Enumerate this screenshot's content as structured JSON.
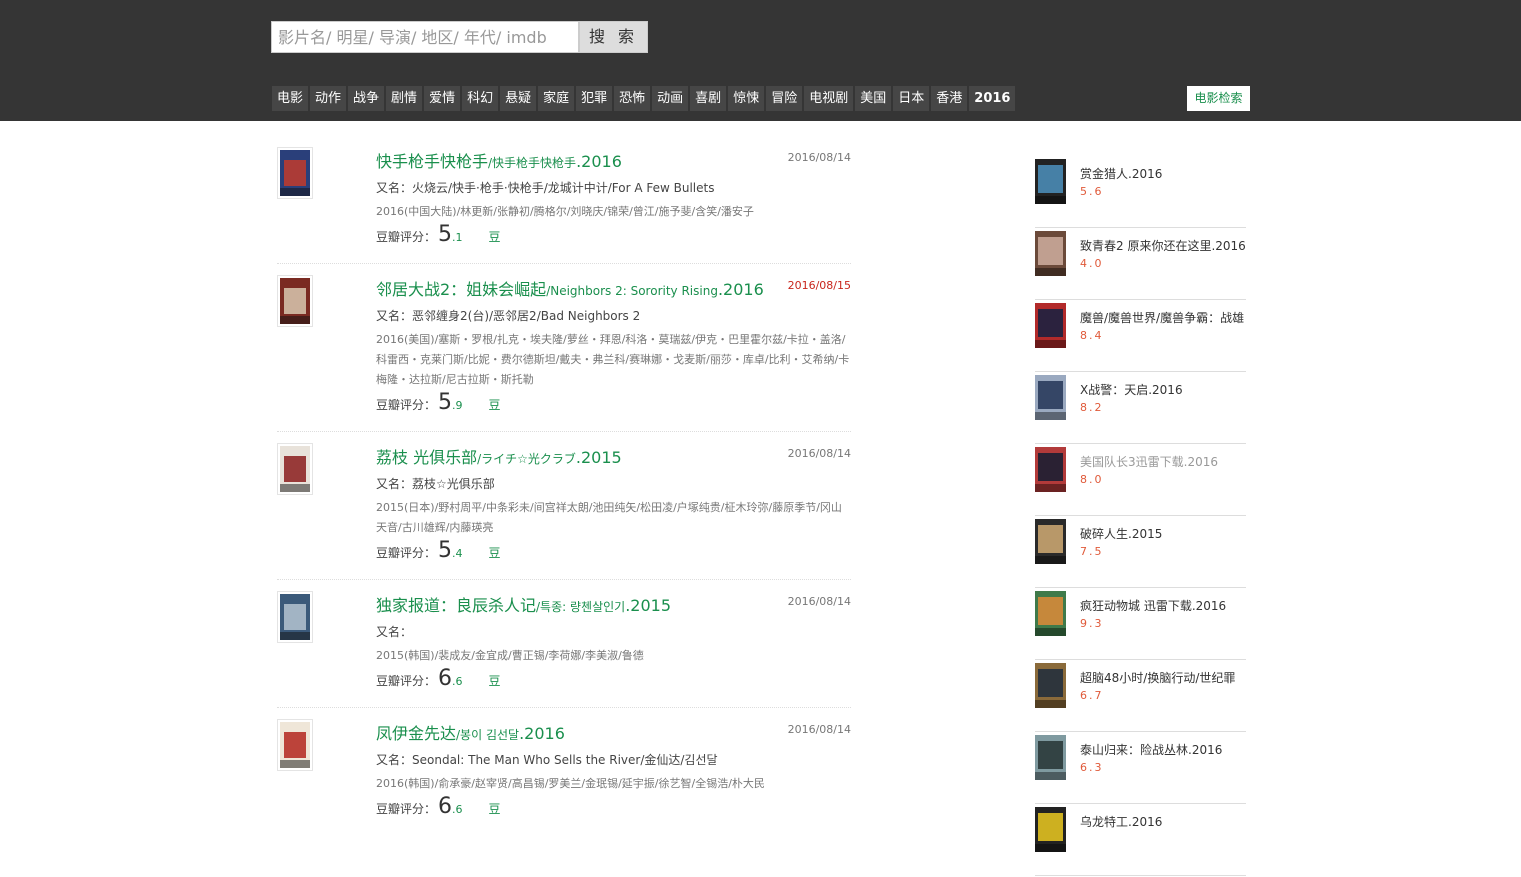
{
  "search": {
    "placeholder": "影片名/ 明星/ 导演/ 地区/ 年代/ imdb",
    "button": "搜 索"
  },
  "nav": {
    "items": [
      "电影",
      "动作",
      "战争",
      "剧情",
      "爱情",
      "科幻",
      "悬疑",
      "家庭",
      "犯罪",
      "恐怖",
      "动画",
      "喜剧",
      "惊悚",
      "冒险",
      "电视剧",
      "美国",
      "日本",
      "香港",
      "2016"
    ],
    "right": "电影检索"
  },
  "movies": [
    {
      "title": "快手枪手快枪手",
      "subtitle": "/快手枪手快枪手",
      "year": ".2016",
      "date": "2016/08/14",
      "date_color": "#777777",
      "aka_label": "又名：",
      "aka": "火烧云/快手·枪手·快枪手/龙城计中计/For A Few Bullets",
      "cast": "2016(中国大陆)/林更新/张静初/腾格尔/刘晓庆/锦荣/曾江/施予斐/含笑/潘安子",
      "rating_label": "豆瓣评分：",
      "score_int": "5",
      "score_dec": ".1",
      "dou": "豆",
      "poster_colors": [
        "#2a3f7a",
        "#c23b2b"
      ]
    },
    {
      "title": "邻居大战2：姐妹会崛起",
      "subtitle": "/Neighbors 2: Sorority Rising",
      "year": ".2016",
      "date": "2016/08/15",
      "date_color": "#c8251c",
      "aka_label": "又名：",
      "aka": "恶邻缠身2(台)/恶邻居2/Bad Neighbors 2",
      "cast": "2016(美国)/塞斯・罗根/扎克・埃夫隆/萝丝・拜恩/科洛・莫瑞兹/伊克・巴里霍尔兹/卡拉・盖洛/科雷西・克莱门斯/比妮・费尔德斯坦/戴夫・弗兰科/赛琳娜・戈麦斯/丽莎・库卓/比利・艾希纳/卡梅隆・达拉斯/尼古拉斯・斯托勒",
      "rating_label": "豆瓣评分：",
      "score_int": "5",
      "score_dec": ".9",
      "dou": "豆",
      "poster_colors": [
        "#7a2a22",
        "#d9c8b0"
      ]
    },
    {
      "title": "荔枝 光俱乐部",
      "subtitle": "/ライチ☆光クラブ",
      "year": ".2015",
      "date": "2016/08/14",
      "date_color": "#777777",
      "aka_label": "又名：",
      "aka": "荔枝☆光俱乐部",
      "cast": "2015(日本)/野村周平/中条彩未/间宫祥太朗/池田纯矢/松田凌/户塚纯贵/柾木玲弥/藤原季节/冈山天音/古川雄辉/内藤瑛亮",
      "rating_label": "豆瓣评分：",
      "score_int": "5",
      "score_dec": ".4",
      "dou": "豆",
      "poster_colors": [
        "#e8e2da",
        "#8a1c1c"
      ]
    },
    {
      "title": "独家报道：良辰杀人记",
      "subtitle": "/특종: 량첸살인기",
      "year": ".2015",
      "date": "2016/08/14",
      "date_color": "#777777",
      "aka_label": "又名：",
      "aka": "",
      "cast": "2015(韩国)/裴成友/金宜成/曹正锡/李荷娜/李美淑/鲁德",
      "rating_label": "豆瓣评分：",
      "score_int": "6",
      "score_dec": ".6",
      "dou": "豆",
      "poster_colors": [
        "#3b5a7a",
        "#b5c4d1"
      ]
    },
    {
      "title": "凤伊金先达",
      "subtitle": "/봉이 김선달",
      "year": ".2016",
      "date": "2016/08/14",
      "date_color": "#777777",
      "aka_label": "又名：",
      "aka": "Seondal: The Man Who Sells the River/金仙达/김선달",
      "cast": "2016(韩国)/俞承豪/赵宰贤/高昌锡/罗美兰/金珉锡/延宇振/徐艺智/全锡浩/朴大民",
      "rating_label": "豆瓣评分：",
      "score_int": "6",
      "score_dec": ".6",
      "dou": "豆",
      "poster_colors": [
        "#efe6d8",
        "#b3261e"
      ]
    }
  ],
  "sidebar": [
    {
      "title": "赏金猎人.2016",
      "score": "5.6",
      "gray": false,
      "colors": [
        "#4a8bb5",
        "#222"
      ]
    },
    {
      "title": "致青春2 原来你还在这里.2016",
      "score": "4.0",
      "gray": false,
      "colors": [
        "#caa99a",
        "#6b4a3a"
      ]
    },
    {
      "title": "魔兽/魔兽世界/魔兽争霸：战雄",
      "score": "8.4",
      "gray": false,
      "colors": [
        "#1c2140",
        "#b22a2a"
      ]
    },
    {
      "title": "X战警：天启.2016",
      "score": "8.2",
      "gray": false,
      "colors": [
        "#2a3b5c",
        "#9aa9c0"
      ]
    },
    {
      "title": "美国队长3迅雷下载.2016",
      "score": "8.0",
      "gray": true,
      "colors": [
        "#1b1f33",
        "#b23a3a"
      ]
    },
    {
      "title": "破碎人生.2015",
      "score": "7.5",
      "gray": false,
      "colors": [
        "#c8a470",
        "#2a2a2a"
      ]
    },
    {
      "title": "疯狂动物城 迅雷下载.2016",
      "score": "9.3",
      "gray": false,
      "colors": [
        "#d58a3a",
        "#3f7a4a"
      ]
    },
    {
      "title": "超脑48小时/换脑行动/世纪罪",
      "score": "6.7",
      "gray": false,
      "colors": [
        "#23303d",
        "#8a6a3a"
      ]
    },
    {
      "title": "泰山归来：险战丛林.2016",
      "score": "6.3",
      "gray": false,
      "colors": [
        "#2b3a3a",
        "#7f9aa0"
      ]
    },
    {
      "title": "乌龙特工.2016",
      "score": "",
      "gray": false,
      "colors": [
        "#e0c020",
        "#222"
      ]
    }
  ]
}
